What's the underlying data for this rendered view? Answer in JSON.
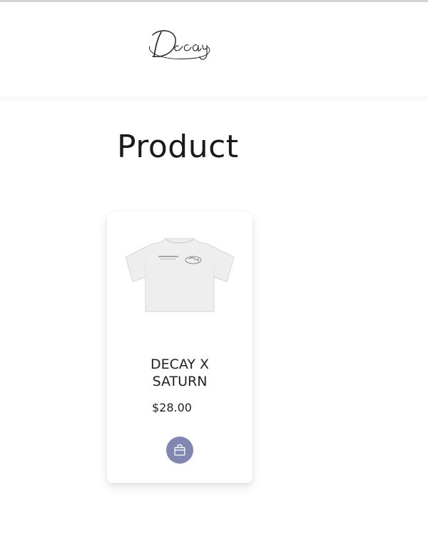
{
  "header": {
    "logo_text": "Decay",
    "logo_icon": "decay-script-logo"
  },
  "main": {
    "title": "Product"
  },
  "products": [
    {
      "name": "DECAY X SATURN",
      "price": "$28.00",
      "image_icon": "white-tshirt-image",
      "cart_icon": "shopping-bag-icon"
    }
  ],
  "colors": {
    "cart_button": "#8187b0",
    "title_text": "#1a1a1a",
    "body_text": "#222222",
    "top_border": "#d4d4d4"
  }
}
